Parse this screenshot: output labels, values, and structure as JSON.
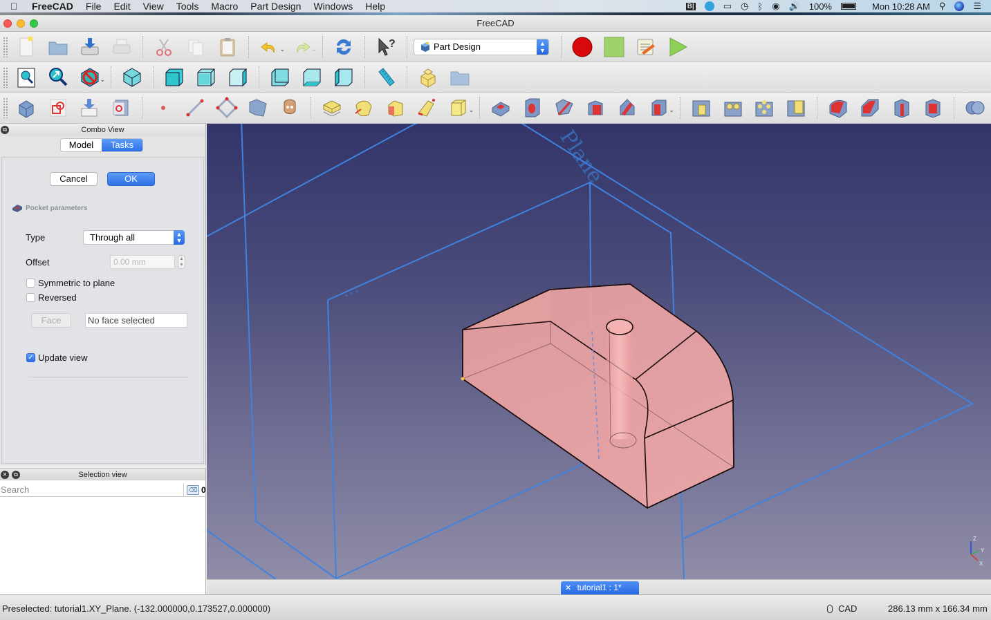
{
  "menubar": {
    "app_name": "FreeCAD",
    "items": [
      "File",
      "Edit",
      "View",
      "Tools",
      "Macro",
      "Part Design",
      "Windows",
      "Help"
    ],
    "status_icons": [
      "bbedit-icon",
      "seafile-icon",
      "airplay-icon",
      "time-machine-icon",
      "bluetooth-icon",
      "wifi-icon",
      "volume-icon"
    ],
    "battery": "100%",
    "clock": "Mon 10:28 AM"
  },
  "window": {
    "title": "FreeCAD"
  },
  "toolbar": {
    "workbench": "Part Design",
    "row1": [
      "new-document",
      "open-document",
      "save-document",
      "print",
      "cut",
      "copy",
      "paste",
      "undo",
      "redo",
      "refresh",
      "whats-this",
      "macro-record",
      "macro-stop",
      "macro-edit",
      "macro-run"
    ],
    "row2": [
      "fit-all",
      "fit-selection",
      "draw-style",
      "isometric-view",
      "front-view",
      "top-view",
      "right-view",
      "rear-view",
      "bottom-view",
      "left-view",
      "measure-distance",
      "create-part",
      "create-group"
    ],
    "row3": [
      "create-body",
      "create-sketch",
      "validate-sketch",
      "attachment",
      "datum-point",
      "datum-line",
      "datum-plane",
      "shape-binder",
      "clone",
      "pad",
      "revolution",
      "additive-loft",
      "additive-pipe",
      "additive-primitive",
      "pocket",
      "hole",
      "groove",
      "subtractive-loft",
      "subtractive-pipe",
      "subtractive-primitive",
      "mirrored",
      "linear-pattern",
      "polar-pattern",
      "multitransform",
      "fillet",
      "chamfer",
      "draft",
      "thickness",
      "boolean"
    ]
  },
  "combo_view": {
    "title": "Combo View",
    "tabs": [
      {
        "label": "Model",
        "active": false
      },
      {
        "label": "Tasks",
        "active": true
      }
    ],
    "cancel_label": "Cancel",
    "ok_label": "OK",
    "section_title": "Pocket parameters",
    "type_label": "Type",
    "type_value": "Through all",
    "offset_label": "Offset",
    "offset_value": "0.00 mm",
    "symmetric_label": "Symmetric to plane",
    "symmetric_checked": false,
    "reversed_label": "Reversed",
    "reversed_checked": false,
    "face_button": "Face",
    "face_field": "No face selected",
    "update_view_label": "Update view",
    "update_view_checked": true
  },
  "selection_view": {
    "title": "Selection view",
    "search_placeholder": "Search",
    "count": "0"
  },
  "viewport": {
    "plane_label": "Plane",
    "axis_labels": {
      "x": "X",
      "y": "Y",
      "z": "Z"
    },
    "colors": {
      "plane_lines": "#3f82e0",
      "solid_fill": "#f0a4a4",
      "edge": "#1b0d0d"
    }
  },
  "document_tab": {
    "label": "tutorial1 : 1*"
  },
  "statusbar": {
    "message": "Preselected: tutorial1.XY_Plane. (-132.000000,0.173527,0.000000)",
    "nav_style": "CAD",
    "dimensions": "286.13 mm x 166.34 mm"
  }
}
